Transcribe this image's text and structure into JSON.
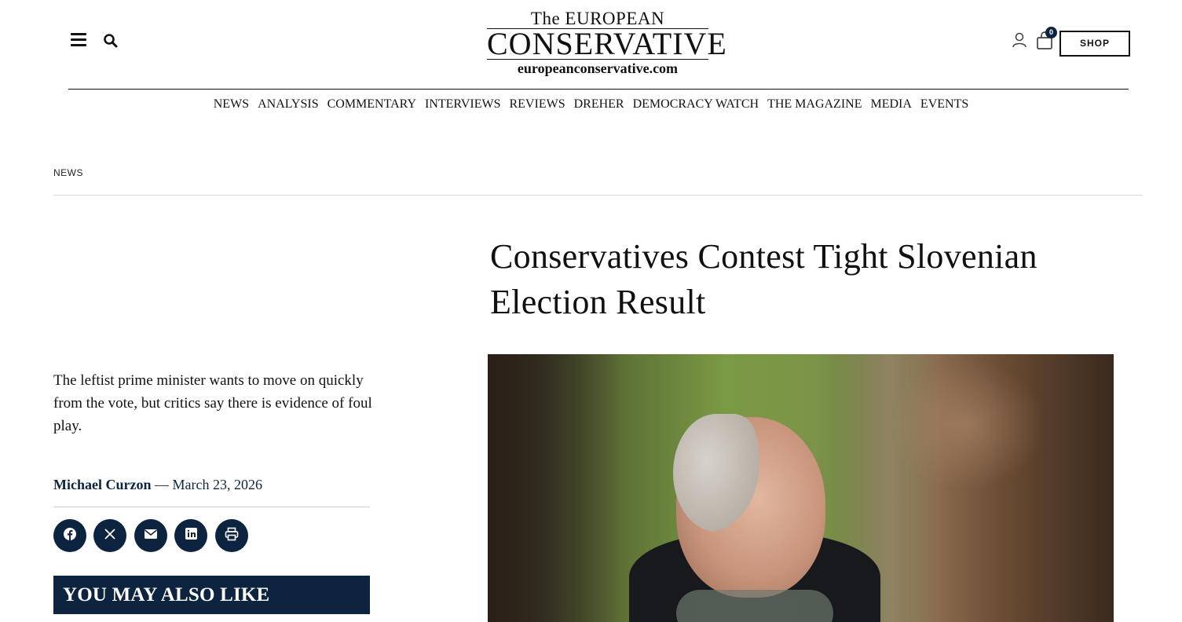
{
  "header": {
    "logo": {
      "top": "The EUROPEAN",
      "main": "CONSERVATIVE",
      "url": "europeanconservative.com"
    },
    "cart_count": "0",
    "shop_label": "SHOP",
    "icons": [
      "hamburger-menu-icon",
      "search-icon",
      "user-icon",
      "shopping-bag-icon"
    ]
  },
  "nav": {
    "items": [
      {
        "label": "NEWS"
      },
      {
        "label": "ANALYSIS"
      },
      {
        "label": "COMMENTARY"
      },
      {
        "label": "INTERVIEWS"
      },
      {
        "label": "REVIEWS"
      },
      {
        "label": "DREHER"
      },
      {
        "label": "DEMOCRACY WATCH"
      },
      {
        "label": "THE MAGAZINE"
      },
      {
        "label": "MEDIA"
      },
      {
        "label": "EVENTS"
      }
    ]
  },
  "article": {
    "category": "NEWS",
    "title": "Conservatives Contest Tight Slovenian Election Result",
    "dek": "The leftist prime minister wants to move on quickly from the vote, but critics say there is evidence of foul play.",
    "author": "Michael Curzon",
    "separator": "—",
    "date": "March 23, 2026",
    "share_icons": [
      "facebook-icon",
      "x-icon",
      "email-icon",
      "linkedin-icon",
      "print-icon"
    ]
  },
  "sidebar": {
    "you_may_also_like": "YOU MAY ALSO LIKE"
  },
  "colors": {
    "navy": "#0d2440",
    "text": "#111111",
    "rule": "#d7d7d7"
  }
}
